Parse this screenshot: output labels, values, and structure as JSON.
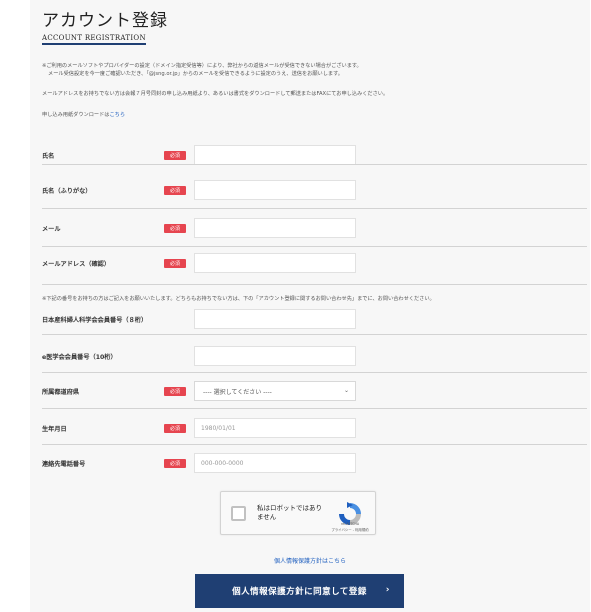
{
  "header": {
    "title": "アカウント登録",
    "subtitle": "ACCOUNT REGISTRATION"
  },
  "notices": {
    "line1": "※ご利用のメールソフトやプロバイダーの設定（ドメイン指定受信等）により、弊社からの返信メールが受信できない場合がございます。",
    "line2": "メール受信設定を今一度ご確認いただき、「@jsng.or.jp」からのメールを受信できるように設定のうえ、送信をお願いします。",
    "line3": "メールアドレスをお持ちでない方は会報７月号同封の申し込み用紙より、あるいは書式をダウンロードして郵送またはFAXにてお申し込みください。",
    "download_prefix": "申し込み用紙ダウンロードは",
    "download_link": "こちら",
    "members_note": "※下記の番号をお持ちの方はご記入をお願いいたします。どちらもお持ちでない方は、下の「アカウント登録に関するお問い合わせ先」までに、お問い合わせください。"
  },
  "required_label": "必須",
  "fields": {
    "name": {
      "label": "氏名",
      "value": ""
    },
    "kana": {
      "label": "氏名（ふりがな）",
      "value": ""
    },
    "email": {
      "label": "メール",
      "value": ""
    },
    "email_confirm": {
      "label": "メールアドレス（確認）",
      "value": ""
    },
    "member_no": {
      "label": "日本産科婦人科学会会員番号（８桁）",
      "value": ""
    },
    "emed_no": {
      "label": "e医学会会員番号（10桁）",
      "value": ""
    },
    "prefecture": {
      "label": "所属都道府県",
      "selected": "---- 選択してください ----"
    },
    "birthday": {
      "label": "生年月日",
      "placeholder": "1980/01/01"
    },
    "phone": {
      "label": "連絡先電話番号",
      "placeholder": "000-000-0000"
    }
  },
  "captcha": {
    "label_line1": "私はロボットではあり",
    "label_line2": "ません",
    "brand": "reCAPTCHA",
    "terms": "プライバシー - 利用規約"
  },
  "footer": {
    "privacy_prefix": "個人情報保護方針は",
    "privacy_link": "こちら",
    "submit_label": "個人情報保護方針に同意して登録",
    "submit_arrow": "›"
  },
  "colors": {
    "accent": "#1f3f73",
    "required": "#e6454f",
    "link": "#1f5fbf"
  }
}
